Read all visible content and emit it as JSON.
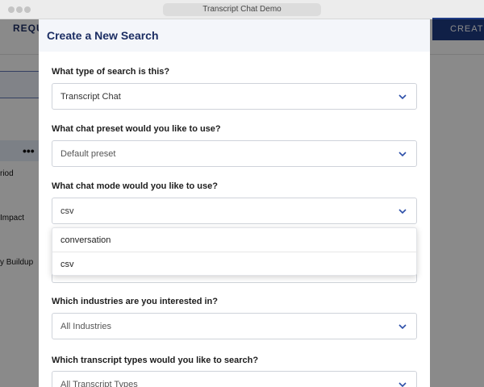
{
  "window": {
    "title": "Transcript Chat Demo"
  },
  "background": {
    "nav_left": "REQUE",
    "create_label": "CREATE",
    "items": [
      "riod",
      "Impact",
      "y Buildup"
    ]
  },
  "modal": {
    "title": "Create a New Search",
    "fields": [
      {
        "question": "What type of search is this?",
        "value": "Transcript Chat"
      },
      {
        "question": "What chat preset would you like to use?",
        "value": "Default preset"
      },
      {
        "question": "What chat mode would you like to use?",
        "value": "csv"
      },
      {
        "question": "Which industries are you interested in?",
        "value": "All Industries"
      },
      {
        "question": "Which transcript types would you like to search?",
        "value": "All Transcript Types"
      }
    ],
    "chat_mode_options": [
      "conversation",
      "csv"
    ]
  },
  "colors": {
    "accent": "#1c2e63",
    "chevron": "#2b4ea8",
    "create_button": "#1f3b83"
  },
  "icons": {
    "select_chevron": "chevron-down-icon"
  }
}
